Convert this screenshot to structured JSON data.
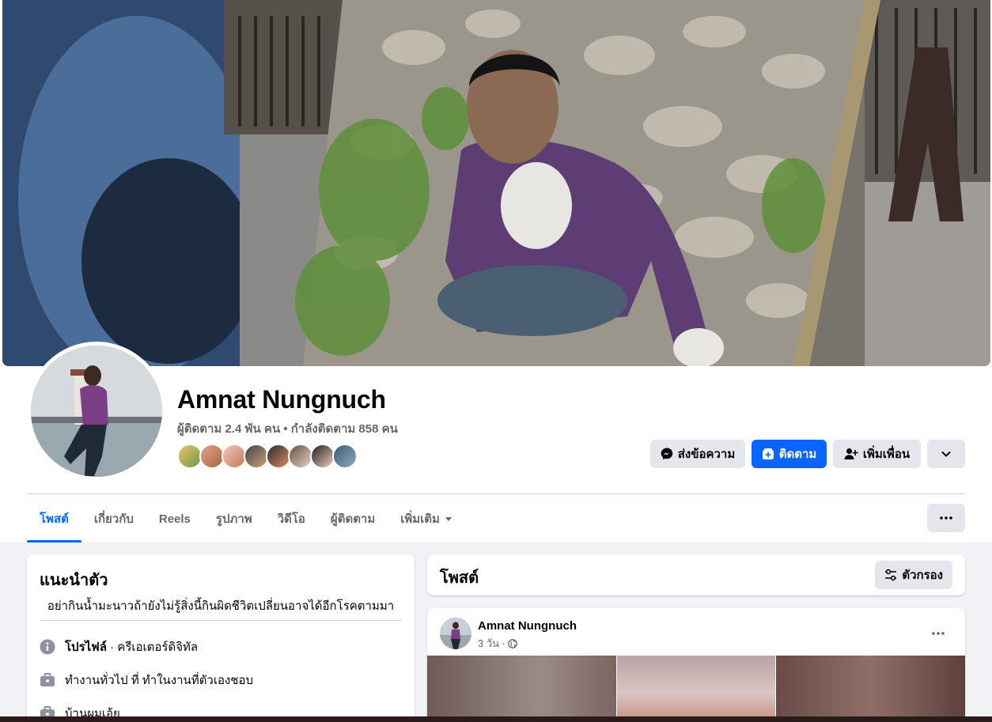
{
  "profile": {
    "name": "Amnat Nungnuch",
    "followers_text": "ผู้ติดตาม 2.4 พัน คน • กำลังติดตาม 858 คน"
  },
  "actions": {
    "message_label": "ส่งข้อความ",
    "follow_label": "ติดตาม",
    "add_friend_label": "เพิ่มเพื่อน"
  },
  "tabs": [
    {
      "label": "โพสต์",
      "active": true
    },
    {
      "label": "เกี่ยวกับ"
    },
    {
      "label": "Reels"
    },
    {
      "label": "รูปภาพ"
    },
    {
      "label": "วิดีโอ"
    },
    {
      "label": "ผู้ติดตาม"
    },
    {
      "label": "เพิ่มเติม"
    }
  ],
  "intro": {
    "title": "แนะนำตัว",
    "bio": "อย่ากินน้ำมะนาวถ้ายังไม่รู้สิ่งนี้กินผิดชีวิตเปลี่ยนอาจได้อีกโรคตามมา",
    "profile_label": "โปรไฟล์",
    "profile_value": " · ครีเอเตอร์ดิจิทัล",
    "work": "ทำงานทั่วไป ที่ ทำในงานที่ตัวเองชอบ",
    "home": "บ้านผมเอ้ย"
  },
  "posts": {
    "title": "โพสต์",
    "filter_label": "ตัวกรอง"
  },
  "post": {
    "author": "Amnat Nungnuch",
    "time": "3 วัน ·"
  },
  "colors": {
    "accent": "#0866ff",
    "button_grey": "#e4e6eb",
    "secondary_text": "#65676b",
    "background": "#f0f2f5"
  }
}
